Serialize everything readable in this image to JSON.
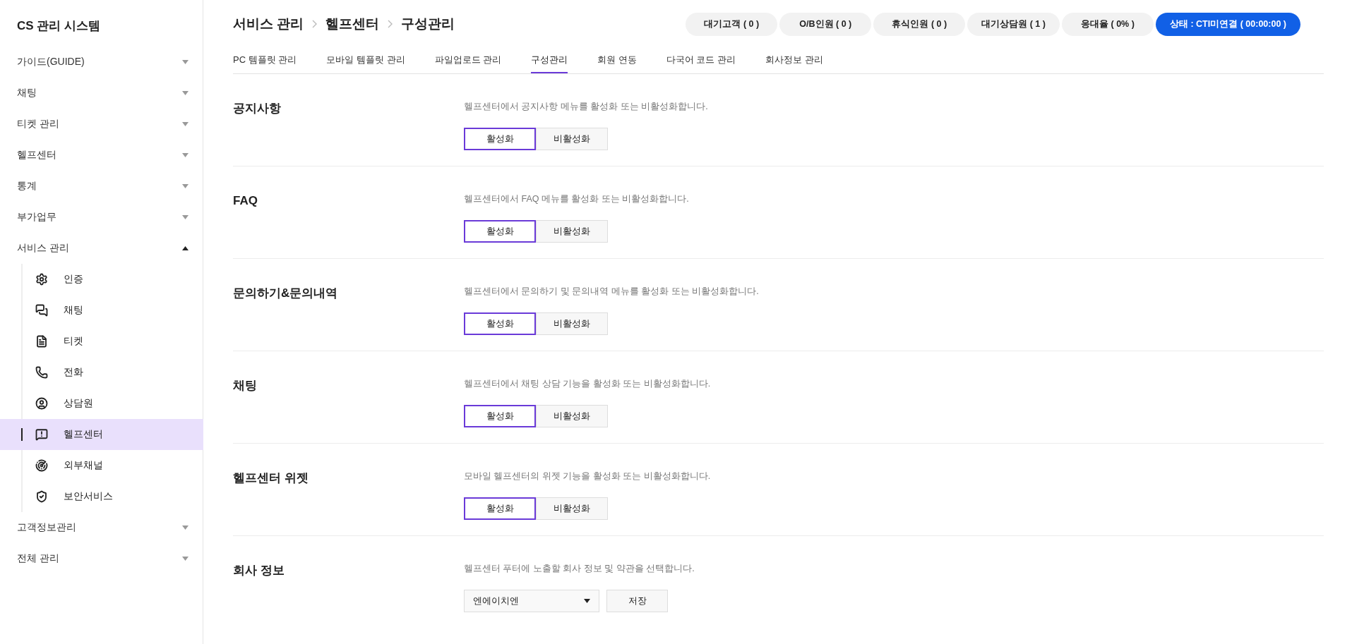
{
  "sidebar": {
    "title": "CS 관리 시스템",
    "items": [
      {
        "label": "가이드(GUIDE)",
        "expanded": false
      },
      {
        "label": "채팅",
        "expanded": false
      },
      {
        "label": "티켓 관리",
        "expanded": false
      },
      {
        "label": "헬프센터",
        "expanded": false
      },
      {
        "label": "통계",
        "expanded": false
      },
      {
        "label": "부가업무",
        "expanded": false
      },
      {
        "label": "서비스 관리",
        "expanded": true,
        "children": [
          {
            "label": "인증",
            "selected": false
          },
          {
            "label": "채팅",
            "selected": false
          },
          {
            "label": "티켓",
            "selected": false
          },
          {
            "label": "전화",
            "selected": false
          },
          {
            "label": "상담원",
            "selected": false
          },
          {
            "label": "헬프센터",
            "selected": true
          },
          {
            "label": "외부채널",
            "selected": false
          },
          {
            "label": "보안서비스",
            "selected": false
          }
        ]
      },
      {
        "label": "고객정보관리",
        "expanded": false
      },
      {
        "label": "전체 관리",
        "expanded": false
      }
    ]
  },
  "breadcrumb": [
    "서비스 관리",
    "헬프센터",
    "구성관리"
  ],
  "status_pills": [
    {
      "label": "대기고객 ( 0 )",
      "kind": "count"
    },
    {
      "label": "O/B인원 ( 0 )",
      "kind": "count"
    },
    {
      "label": "휴식인원 ( 0 )",
      "kind": "count"
    },
    {
      "label": "대기상담원 ( 1 )",
      "kind": "count"
    },
    {
      "label": "응대율 ( 0% )",
      "kind": "count"
    },
    {
      "label": "상태 : CTI미연결 ( 00:00:00 )",
      "kind": "status"
    }
  ],
  "tabs": [
    {
      "label": "PC 템플릿 관리",
      "selected": false
    },
    {
      "label": "모바일 템플릿 관리",
      "selected": false
    },
    {
      "label": "파일업로드 관리",
      "selected": false
    },
    {
      "label": "구성관리",
      "selected": true
    },
    {
      "label": "회원 연동",
      "selected": false
    },
    {
      "label": "다국어 코드 관리",
      "selected": false
    },
    {
      "label": "회사정보 관리",
      "selected": false
    }
  ],
  "sections": [
    {
      "kind": "toggle",
      "title": "공지사항",
      "description": "헬프센터에서 공지사항 메뉴를 활성화 또는 비활성화합니다.",
      "options": [
        {
          "label": "활성화",
          "selected": true
        },
        {
          "label": "비활성화",
          "selected": false
        }
      ]
    },
    {
      "kind": "toggle",
      "title": "FAQ",
      "description": "헬프센터에서 FAQ 메뉴를 활성화 또는 비활성화합니다.",
      "options": [
        {
          "label": "활성화",
          "selected": true
        },
        {
          "label": "비활성화",
          "selected": false
        }
      ]
    },
    {
      "kind": "toggle",
      "title": "문의하기&문의내역",
      "description": "헬프센터에서 문의하기 및 문의내역 메뉴를 활성화 또는 비활성화합니다.",
      "options": [
        {
          "label": "활성화",
          "selected": true
        },
        {
          "label": "비활성화",
          "selected": false
        }
      ]
    },
    {
      "kind": "toggle",
      "title": "채팅",
      "description": "헬프센터에서 채팅 상담 기능을 활성화 또는 비활성화합니다.",
      "options": [
        {
          "label": "활성화",
          "selected": true
        },
        {
          "label": "비활성화",
          "selected": false
        }
      ]
    },
    {
      "kind": "toggle",
      "title": "헬프센터 위젯",
      "description": "모바일 헬프센터의 위젯 기능을 활성화 또는 비활성화합니다.",
      "options": [
        {
          "label": "활성화",
          "selected": true
        },
        {
          "label": "비활성화",
          "selected": false
        }
      ]
    },
    {
      "kind": "select",
      "title": "회사 정보",
      "description": "헬프센터 푸터에 노출할 회사 정보 및 약관을 선택합니다.",
      "value": "엔에이치엔",
      "button": "저장"
    }
  ]
}
